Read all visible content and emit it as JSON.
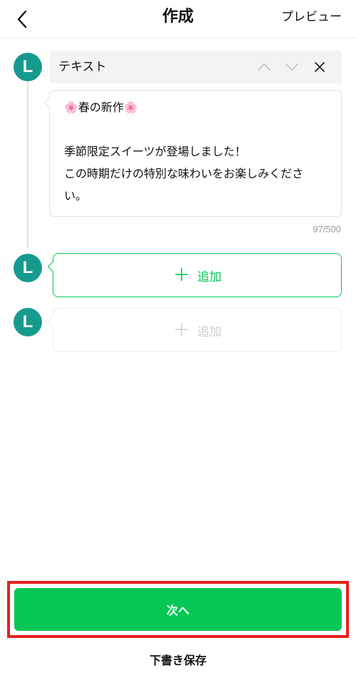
{
  "header": {
    "back_icon": "chevron-left-icon",
    "title": "作成",
    "preview_label": "プレビュー"
  },
  "avatar_letter": "L",
  "text_block": {
    "type_label": "テキスト",
    "controls": [
      "chevron-up-icon",
      "chevron-down-icon",
      "close-icon"
    ],
    "content": "🌸春の新作🌸\n\n季節限定スイーツが登場しました！\nこの時期だけの特別な味わいをお楽しみくださ\nい。",
    "counter": "97/500"
  },
  "add_buttons": [
    {
      "label": "追加",
      "state": "enabled"
    },
    {
      "label": "追加",
      "state": "disabled"
    }
  ],
  "footer": {
    "next_label": "次へ",
    "draft_label": "下書き保存"
  },
  "colors": {
    "accent": "#06c755",
    "avatar": "#169a8d",
    "highlight": "#e8201a"
  }
}
